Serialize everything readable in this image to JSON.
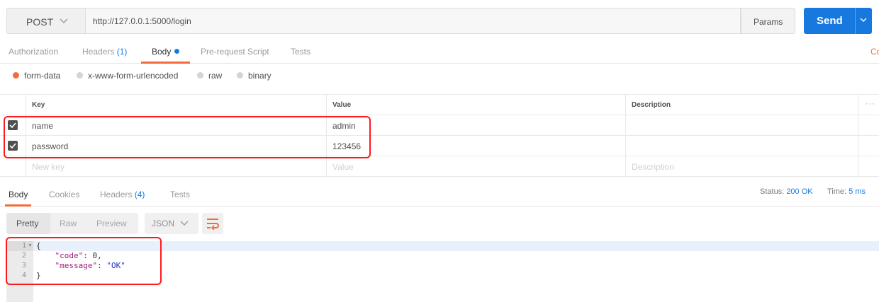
{
  "request": {
    "method": "POST",
    "url": "http://127.0.0.1:5000/login",
    "params_label": "Params",
    "send_label": "Send"
  },
  "request_tabs": {
    "authorization": "Authorization",
    "headers": "Headers",
    "headers_count": "(1)",
    "body": "Body",
    "prerequest": "Pre-request Script",
    "tests": "Tests",
    "cookies_partial": "Co"
  },
  "body_types": {
    "form_data": "form-data",
    "urlencoded": "x-www-form-urlencoded",
    "raw": "raw",
    "binary": "binary",
    "selected": "form-data"
  },
  "kv_table": {
    "headers": {
      "key": "Key",
      "value": "Value",
      "description": "Description",
      "more": "···"
    },
    "rows": [
      {
        "checked": true,
        "key": "name",
        "value": "admin",
        "description": ""
      },
      {
        "checked": true,
        "key": "password",
        "value": "123456",
        "description": ""
      }
    ],
    "new_row": {
      "key": "New key",
      "value": "Value",
      "description": "Description"
    }
  },
  "response_tabs": {
    "body": "Body",
    "cookies": "Cookies",
    "headers": "Headers",
    "headers_count": "(4)",
    "tests": "Tests"
  },
  "response_status": {
    "status_label": "Status:",
    "status_value": "200 OK",
    "time_label": "Time:",
    "time_value": "5 ms"
  },
  "format_bar": {
    "pretty": "Pretty",
    "raw": "Raw",
    "preview": "Preview",
    "language": "JSON"
  },
  "response_body": {
    "line_numbers": [
      "1",
      "2",
      "3",
      "4"
    ],
    "open_brace": "{",
    "code_key": "\"code\"",
    "code_value": "0",
    "message_key": "\"message\"",
    "message_value": "\"OK\"",
    "close_brace": "}"
  },
  "colors": {
    "accent": "#f26b3a",
    "primary": "#1779e0",
    "highlight_box": "#ff1a1a"
  }
}
